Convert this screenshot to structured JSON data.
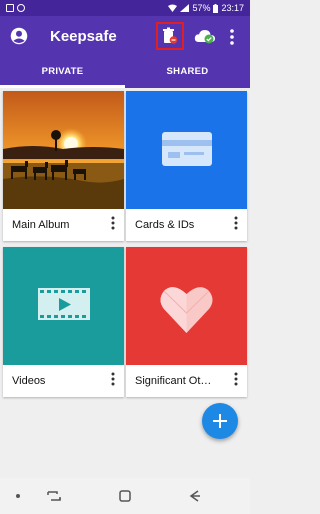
{
  "status_bar": {
    "signal": "57%",
    "time": "23:17"
  },
  "app_bar": {
    "title": "Keepsafe",
    "icons": [
      "account-circle-icon",
      "trash-icon",
      "cloud-check-icon",
      "more-vert-icon"
    ]
  },
  "tabs": [
    {
      "label": "PRIVATE",
      "selected": true
    },
    {
      "label": "SHARED",
      "selected": false
    }
  ],
  "albums": [
    {
      "label": "Main Album",
      "thumbnail": "savanna-sunset-photo"
    },
    {
      "label": "Cards & IDs",
      "thumbnail": "card-icon",
      "color": "#1a73e8"
    },
    {
      "label": "Videos",
      "thumbnail": "film-play-icon",
      "color": "#1a9c9c"
    },
    {
      "label": "Significant Ot…",
      "thumbnail": "heart-icon",
      "color": "#e53935"
    }
  ],
  "fab": {
    "icon": "plus-icon",
    "color": "#1e88e5"
  },
  "colors": {
    "brand": "#5534b0",
    "status": "#45269a"
  },
  "nav_bar": {
    "icons": [
      "dot-icon",
      "recent-apps-icon",
      "home-icon",
      "back-icon"
    ]
  }
}
